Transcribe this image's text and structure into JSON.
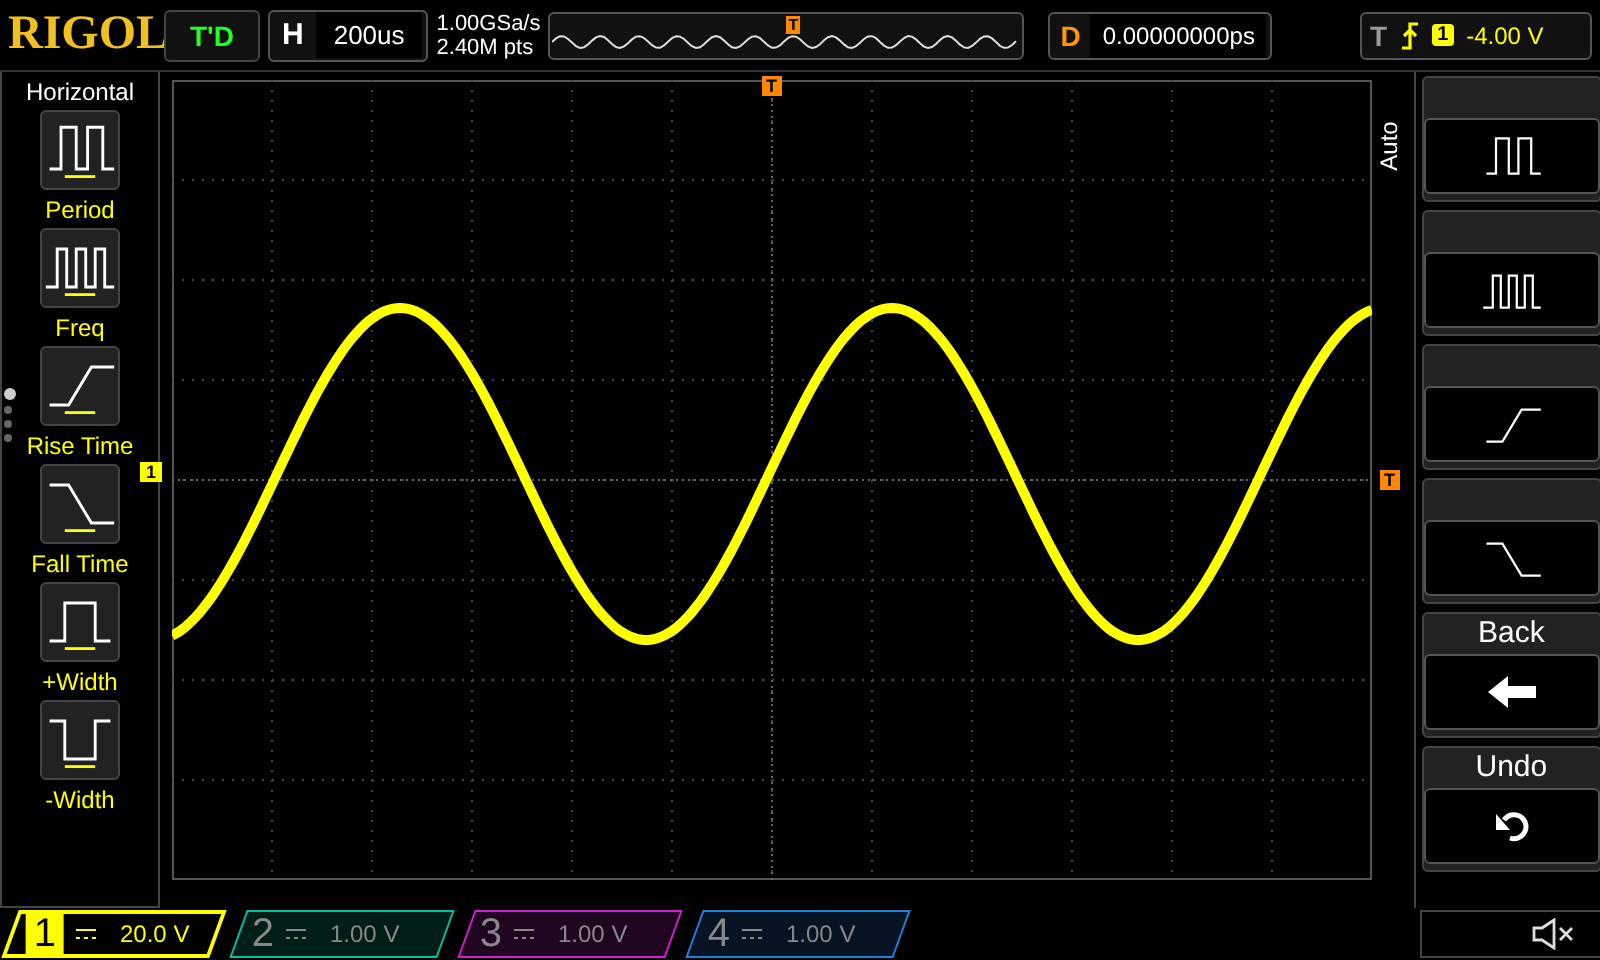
{
  "top_bar": {
    "logo": "RIGOL",
    "run_status": "T'D",
    "horizontal": {
      "label": "H",
      "value": "200us"
    },
    "sample_rate": "1.00GSa/s",
    "memory_depth": "2.40M pts",
    "delay": {
      "label": "D",
      "value": "0.00000000ps"
    },
    "trigger": {
      "label": "T",
      "source": "1",
      "level": "-4.00 V"
    }
  },
  "left_menu": {
    "title": "Horizontal",
    "items": [
      {
        "kind": "period",
        "label": "Period"
      },
      {
        "kind": "freq",
        "label": "Freq"
      },
      {
        "kind": "rise",
        "label": "Rise Time"
      },
      {
        "kind": "fall",
        "label": "Fall Time"
      },
      {
        "kind": "pwidth",
        "label": "+Width"
      },
      {
        "kind": "nwidth",
        "label": "-Width"
      }
    ],
    "pages": [
      {
        "selected": true
      },
      {
        "selected": false
      },
      {
        "selected": false
      },
      {
        "selected": false
      }
    ]
  },
  "memory_trigger_marker": "T",
  "plot": {
    "trigger_position_marker": "T",
    "channel_marker": "1",
    "trigger_level_marker": "T"
  },
  "right_menu": {
    "title": "Auto",
    "buttons": [
      {
        "kind": "period"
      },
      {
        "kind": "freq"
      },
      {
        "kind": "rise"
      },
      {
        "kind": "fall"
      },
      {
        "kind": "back",
        "label": "Back"
      },
      {
        "kind": "undo",
        "label": "Undo"
      }
    ]
  },
  "channels": [
    {
      "number": "1",
      "scale": "20.0 V",
      "on": true,
      "color": "#ffff00"
    },
    {
      "number": "2",
      "scale": "1.00 V",
      "on": false,
      "color": "#00c0a0"
    },
    {
      "number": "3",
      "scale": "1.00 V",
      "on": false,
      "color": "#d020d0"
    },
    {
      "number": "4",
      "scale": "1.00 V",
      "on": false,
      "color": "#2080e0"
    }
  ]
}
